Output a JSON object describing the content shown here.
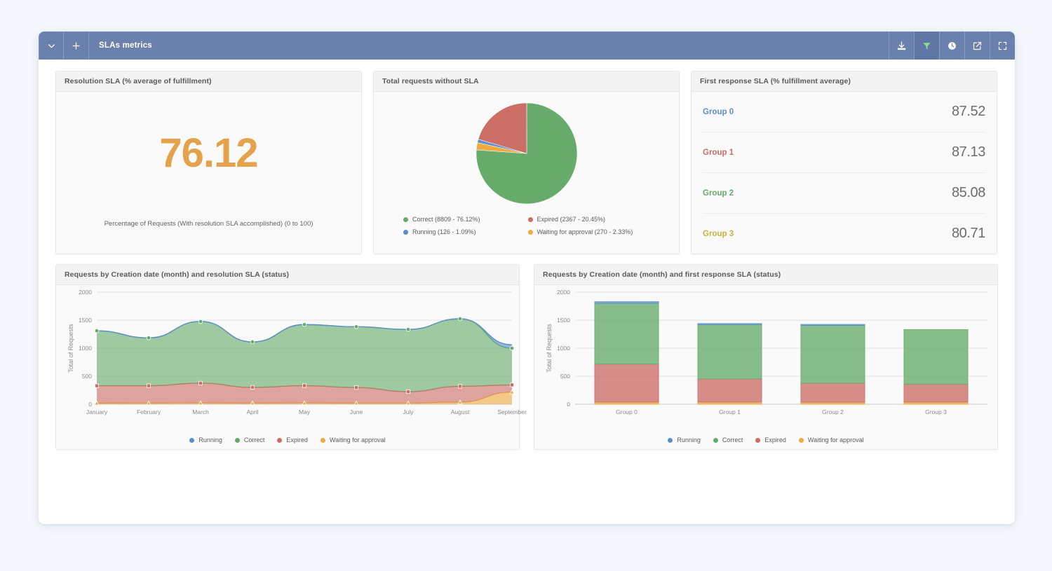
{
  "window": {
    "title": "SLAs metrics",
    "collapse_icon": "chevron-down-icon",
    "add_icon": "plus-icon",
    "toolbar": [
      {
        "name": "download-icon",
        "label": "Download",
        "active": false
      },
      {
        "name": "filter-icon",
        "label": "Filter",
        "active": true
      },
      {
        "name": "clock-icon",
        "label": "Schedule",
        "active": false
      },
      {
        "name": "edit-icon",
        "label": "Edit",
        "active": false
      },
      {
        "name": "fullscreen-icon",
        "label": "Fullscreen",
        "active": false
      }
    ],
    "header_color": "#6a80ad"
  },
  "colors": {
    "running": "#5b8fc9",
    "correct": "#67ab6b",
    "expired": "#cc6d66",
    "waiting": "#eeab44",
    "kpi": "#e5a24c",
    "group0": "#5b8fc9",
    "group1": "#cc6d66",
    "group2": "#67ab6b",
    "group3": "#c7b13f"
  },
  "cards": {
    "resolution_sla": {
      "title": "Resolution SLA (% average of fulfillment)",
      "value": "76.12",
      "caption": "Percentage of Requests (With resolution SLA accomplished) (0 to 100)"
    },
    "total_without_sla": {
      "title": "Total requests without SLA"
    },
    "first_response_sla": {
      "title": "First response SLA (% fulfillment average)",
      "rows": [
        {
          "label": "Group 0",
          "value": "87.52",
          "color": "#5b8fc9"
        },
        {
          "label": "Group 1",
          "value": "87.13",
          "color": "#cc6d66"
        },
        {
          "label": "Group 2",
          "value": "85.08",
          "color": "#67ab6b"
        },
        {
          "label": "Group 3",
          "value": "80.71",
          "color": "#c7b13f"
        }
      ]
    },
    "requests_resolution": {
      "title": "Requests by Creation date (month) and resolution SLA (status)"
    },
    "requests_first_response": {
      "title": "Requests by Creation date (month) and first response SLA (status)"
    }
  },
  "chart_data": [
    {
      "id": "pie-total-requests-without-sla",
      "type": "pie",
      "title": "Total requests without SLA",
      "legend_position": "bottom",
      "start_angle_deg": 0,
      "direction": "clockwise",
      "labels": [
        "Correct",
        "Expired",
        "Running",
        "Waiting for approval"
      ],
      "values": [
        8809,
        2367,
        126,
        270
      ],
      "percents": [
        76.12,
        20.45,
        1.09,
        2.33
      ],
      "colors": [
        "#67ab6b",
        "#cc6d66",
        "#5b8fc9",
        "#eeab44"
      ],
      "legend_entries": [
        {
          "text": "Correct (8809 - 76.12%)",
          "color": "#67ab6b"
        },
        {
          "text": "Expired (2367 - 20.45%)",
          "color": "#cc6d66"
        },
        {
          "text": "Running (126 - 1.09%)",
          "color": "#5b8fc9"
        },
        {
          "text": "Waiting for approval (270 - 2.33%)",
          "color": "#eeab44"
        }
      ],
      "slice_order_clockwise": [
        "Correct",
        "Waiting for approval",
        "Running",
        "Expired"
      ]
    },
    {
      "id": "area-requests-by-month-resolution-sla",
      "type": "area",
      "stacked": true,
      "title": "Requests by Creation date (month) and resolution SLA (status)",
      "xlabel": "",
      "ylabel": "Total of Requests",
      "ylim": [
        0,
        2000
      ],
      "yticks": [
        0,
        500,
        1000,
        1500,
        2000
      ],
      "grid": true,
      "legend_position": "bottom",
      "categories": [
        "January",
        "February",
        "March",
        "April",
        "May",
        "June",
        "July",
        "August",
        "September"
      ],
      "series": [
        {
          "name": "Waiting for approval",
          "color": "#eeab44",
          "values": [
            18,
            20,
            22,
            20,
            22,
            20,
            20,
            35,
            215
          ]
        },
        {
          "name": "Expired",
          "color": "#cc6d66",
          "values": [
            312,
            310,
            355,
            282,
            310,
            278,
            205,
            285,
            130
          ]
        },
        {
          "name": "Correct",
          "color": "#67ab6b",
          "values": [
            980,
            855,
            1100,
            810,
            1090,
            1085,
            1110,
            1205,
            655
          ]
        },
        {
          "name": "Running",
          "color": "#5b8fc9",
          "values": [
            0,
            0,
            0,
            0,
            0,
            0,
            0,
            0,
            60
          ]
        }
      ],
      "totals": [
        1310,
        1185,
        1477,
        1112,
        1422,
        1383,
        1335,
        1525,
        1060
      ]
    },
    {
      "id": "bar-requests-by-group-first-response-sla",
      "type": "bar",
      "stacked": true,
      "title": "Requests by Creation date (month) and first response SLA (status)",
      "xlabel": "",
      "ylabel": "Total of Requests",
      "ylim": [
        0,
        2000
      ],
      "yticks": [
        0,
        500,
        1000,
        1500,
        2000
      ],
      "grid": true,
      "legend_position": "bottom",
      "categories": [
        "Group 0",
        "Group 1",
        "Group 2",
        "Group 3"
      ],
      "series": [
        {
          "name": "Waiting for approval",
          "color": "#eeab44",
          "values": [
            38,
            38,
            35,
            38
          ]
        },
        {
          "name": "Expired",
          "color": "#cc6d66",
          "values": [
            678,
            415,
            342,
            320
          ]
        },
        {
          "name": "Correct",
          "color": "#67ab6b",
          "values": [
            1084,
            967,
            1028,
            975
          ]
        },
        {
          "name": "Running",
          "color": "#5b8fc9",
          "values": [
            30,
            20,
            20,
            0
          ]
        }
      ],
      "totals": [
        1830,
        1440,
        1425,
        1333
      ]
    }
  ],
  "legend_status": [
    {
      "text": "Running",
      "color": "#5b8fc9"
    },
    {
      "text": "Correct",
      "color": "#67ab6b"
    },
    {
      "text": "Expired",
      "color": "#cc6d66"
    },
    {
      "text": "Waiting for approval",
      "color": "#eeab44"
    }
  ]
}
